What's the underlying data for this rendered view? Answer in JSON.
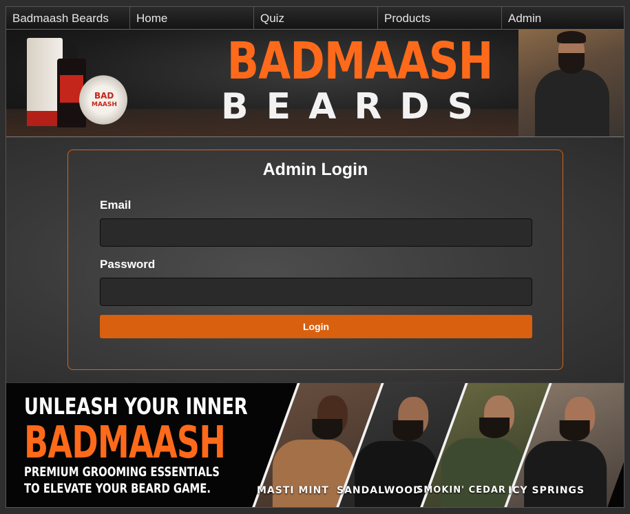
{
  "nav": {
    "items": [
      {
        "label": "Badmaash Beards"
      },
      {
        "label": "Home"
      },
      {
        "label": "Quiz"
      },
      {
        "label": "Products"
      },
      {
        "label": "Admin"
      }
    ]
  },
  "hero": {
    "brand_top": "BADMAASH",
    "brand_bottom": "BEARDS",
    "product_text": {
      "line1": "BAD",
      "line2": "MAASH"
    }
  },
  "login": {
    "title": "Admin Login",
    "email_label": "Email",
    "email_value": "",
    "password_label": "Password",
    "password_value": "",
    "button_label": "Login"
  },
  "banner": {
    "line1": "UNLEASH YOUR INNER",
    "line2": "BADMAASH",
    "line3": "PREMIUM GROOMING ESSENTIALS",
    "line4": "TO ELEVATE YOUR BEARD GAME.",
    "scents": [
      {
        "label": "MASTI MINT"
      },
      {
        "label": "SANDALWOOD"
      },
      {
        "label": "SMOKIN' CEDAR"
      },
      {
        "label": "ICY SPRINGS"
      }
    ]
  },
  "colors": {
    "accent": "#d8600f",
    "brand_orange": "#ff6a1a",
    "card_border": "#d9641a"
  }
}
